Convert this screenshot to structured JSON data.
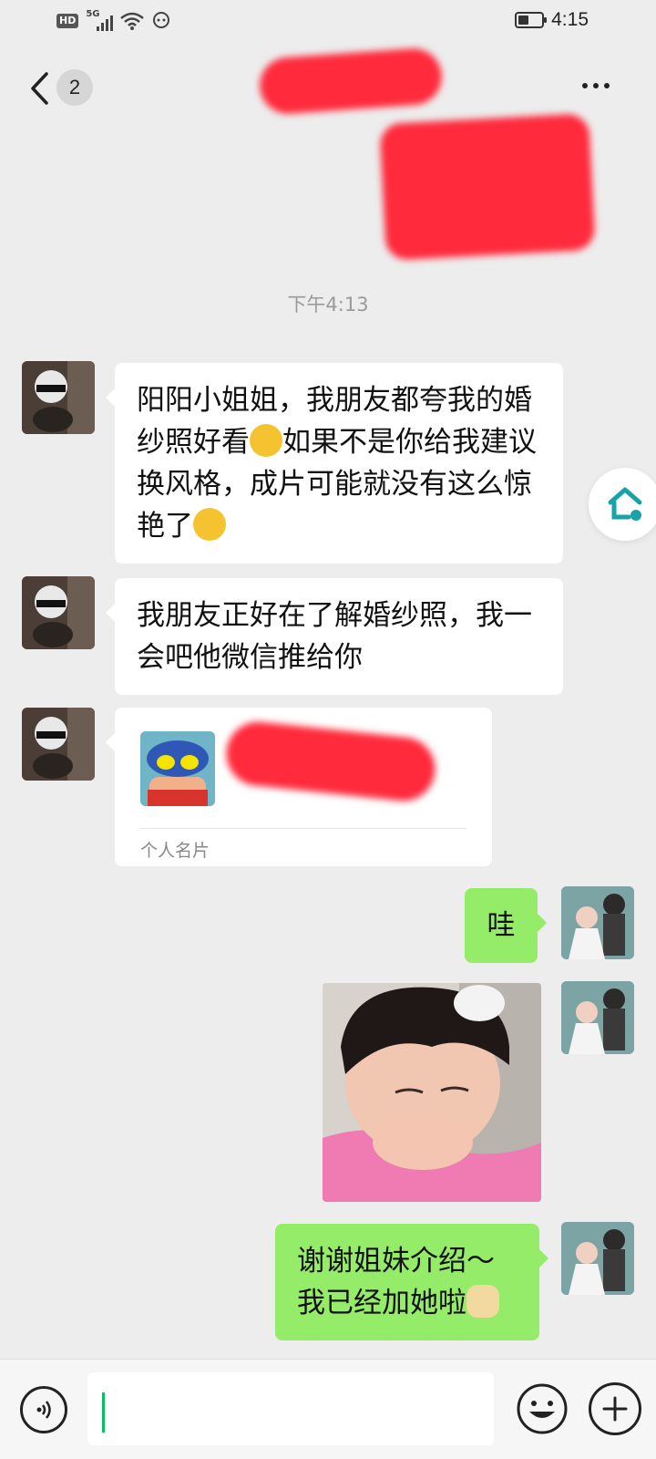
{
  "status_bar": {
    "hd": "HD",
    "network": "5G",
    "time": "4:15",
    "battery_level": 0.45
  },
  "header": {
    "unread_count": "2"
  },
  "chat": {
    "timestamp": "下午4:13",
    "messages": [
      {
        "side": "left",
        "text_1": "阳阳小姐姐，我朋友都夸我的婚纱照好看",
        "text_2": "如果不是你给我建议换风格，成片可能就没有这么惊艳了"
      },
      {
        "side": "left",
        "text": "我朋友正好在了解婚纱照，我一会吧他微信推给你"
      },
      {
        "side": "left",
        "card_label": "个人名片"
      },
      {
        "side": "right",
        "text": "哇"
      },
      {
        "side": "right",
        "type": "image"
      },
      {
        "side": "right",
        "text": "谢谢姐妹介绍～我已经加她啦"
      }
    ]
  },
  "colors": {
    "background": "#ededed",
    "bubble_in": "#ffffff",
    "bubble_out": "#95ec69",
    "accent": "#07c160",
    "redaction": "#ff2a3c"
  },
  "icons": [
    "back-icon",
    "more-icon",
    "voice-icon",
    "emoji-icon",
    "plus-icon",
    "home-icon",
    "wifi-icon",
    "battery-icon",
    "signal-icon"
  ]
}
